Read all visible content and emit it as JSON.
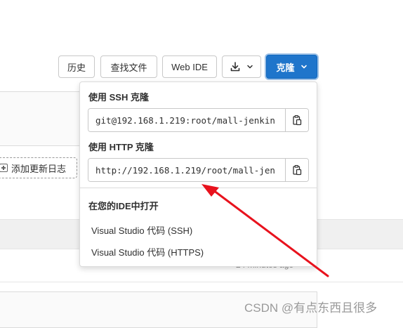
{
  "toolbar": {
    "history_label": "历史",
    "find_file_label": "查找文件",
    "web_ide_label": "Web IDE",
    "download_icon": "download-icon",
    "clone_label": "克隆",
    "clone_color": "#1f75cb"
  },
  "clone_dropdown": {
    "ssh_heading": "使用 SSH 克隆",
    "ssh_url": "git@192.168.1.219:root/mall-jenkin",
    "http_heading": "使用 HTTP 克隆",
    "http_url": "http://192.168.1.219/root/mall-jen",
    "copy_icon": "copy-icon",
    "ide_heading": "在您的IDE中打开",
    "ide_options": [
      "Visual Studio 代码 (SSH)",
      "Visual Studio 代码 (HTTPS)"
    ]
  },
  "background": {
    "add_changelog_label": "添加更新日志",
    "last_commit_time": "24 minutes ago"
  },
  "annotation": {
    "arrow_color": "#e8121d"
  },
  "watermark": "CSDN @有点东西且很多"
}
